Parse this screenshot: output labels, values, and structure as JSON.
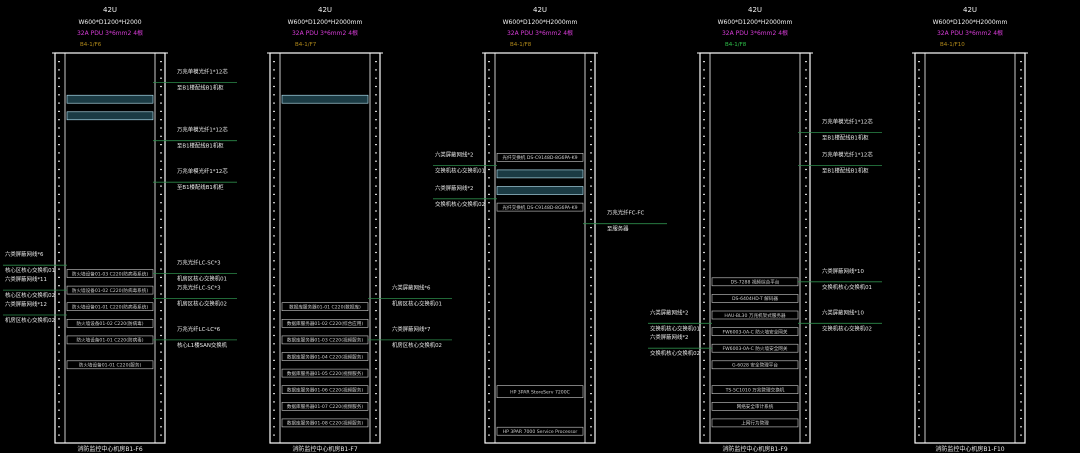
{
  "colors": {
    "background": "#000000",
    "rack": "#ffffff",
    "header": "#f2f2f2",
    "pdu": "#d63bd6",
    "id": "#b38b1a",
    "id_green": "#2ec24a",
    "leader": "#2c8a4a",
    "label": "#eaeaea",
    "device": "#cfcfcf",
    "highlight": "#bfefff"
  },
  "racks": [
    {
      "name": "rack-1",
      "size": "42U",
      "dims": "W600*D1200*H2000",
      "pdu": "32A PDU 3*6mm2 4根",
      "id": "B4-1/F6",
      "id_color": "id",
      "devices": [
        {
          "label": "",
          "u": 4,
          "style": "hl"
        },
        {
          "label": "",
          "u": 6,
          "style": "hl"
        },
        {
          "label": "防火墙设备01-03 C220(防病毒系统)",
          "u": 25
        },
        {
          "label": "防火墙设备01-02 C220(防病毒系统)",
          "u": 27
        },
        {
          "label": "防火墙设备01-01 C220(防病毒系统)",
          "u": 29
        },
        {
          "label": "防火墙设备01-02 C220(防病毒)",
          "u": 31
        },
        {
          "label": "防火墙设备01-01 C220(防病毒)",
          "u": 33
        },
        {
          "label": "防火墙设备01-01 C220(服务)",
          "u": 36
        }
      ],
      "callouts": [
        {
          "side": "right",
          "u": 2,
          "lines": [
            "万兆单模光纤1*12芯",
            "至B1楼配线B1机柜"
          ]
        },
        {
          "side": "right",
          "u": 9,
          "lines": [
            "万兆单模光纤1*12芯",
            "至B1楼配线B1机柜"
          ]
        },
        {
          "side": "right",
          "u": 14,
          "lines": [
            "万兆单模光纤1*12芯",
            "至B1楼配线B1机柜"
          ]
        },
        {
          "side": "right",
          "u": 25,
          "lines": [
            "万兆光纤LC-SC*3",
            "机房区核心交换机01"
          ]
        },
        {
          "side": "right",
          "u": 28,
          "lines": [
            "万兆光纤LC-SC*3",
            "机房区核心交换机02"
          ]
        },
        {
          "side": "right",
          "u": 33,
          "lines": [
            "万兆光纤LC-LC*6",
            "核心L1楼SAN交换机"
          ]
        },
        {
          "side": "left",
          "u": 24,
          "lines": [
            "六类屏蔽网线*6",
            "核心区核心交换机01"
          ]
        },
        {
          "side": "left",
          "u": 27,
          "lines": [
            "六类屏蔽网线*11",
            "核心区核心交换机02"
          ]
        },
        {
          "side": "left",
          "u": 30,
          "lines": [
            "六类屏蔽网线*12",
            "机房区核心交换机02"
          ]
        }
      ],
      "footer": "消防监控中心机房B1-F6"
    },
    {
      "name": "rack-2",
      "size": "42U",
      "dims": "W600*D1200*H2000mm",
      "pdu": "32A PDU 3*6mm2 4根",
      "id": "B4-1/F7",
      "id_color": "id",
      "devices": [
        {
          "label": "",
          "u": 4,
          "style": "hl"
        },
        {
          "label": "数据库服务器01-01 C220(数据库)",
          "u": 29
        },
        {
          "label": "数据库服务器01-02 C220(综合应用)",
          "u": 31
        },
        {
          "label": "数据库服务器01-03 C220(视频服务)",
          "u": 33
        },
        {
          "label": "数据库服务器01-04 C220(视频服务)",
          "u": 35
        },
        {
          "label": "数据库服务器01-05 C220(视频服务)",
          "u": 37
        },
        {
          "label": "数据库服务器01-06 C220(视频服务)",
          "u": 39
        },
        {
          "label": "数据库服务器01-07 C220(视频服务)",
          "u": 41
        },
        {
          "label": "数据库服务器01-08 C220(视频服务)",
          "u": 43
        }
      ],
      "callouts": [
        {
          "side": "right",
          "u": 28,
          "lines": [
            "六类屏蔽网线*6",
            "机房区核心交换机01"
          ]
        },
        {
          "side": "right",
          "u": 33,
          "lines": [
            "六类屏蔽网线*7",
            "机房区核心交换机02"
          ]
        }
      ],
      "footer": "消防监控中心机房B1-F7"
    },
    {
      "name": "rack-3",
      "size": "42U",
      "dims": "W600*D1200*H2000mm",
      "pdu": "32A PDU 3*6mm2 4根",
      "id": "B4-1/F8",
      "id_color": "id",
      "devices": [
        {
          "label": "光纤交换机 DS-C9148D-8G6PA-K9",
          "u": 11
        },
        {
          "label": "",
          "u": 13,
          "style": "hl"
        },
        {
          "label": "",
          "u": 15,
          "style": "hl"
        },
        {
          "label": "光纤交换机 DS-C9148D-8G6PA-K9",
          "u": 17
        },
        {
          "label": "HP 3PAR StoreServ 7200C",
          "u": 39,
          "tall": true
        },
        {
          "label": "HP 3PAR 7000 Service Processor",
          "u": 44
        }
      ],
      "callouts": [
        {
          "side": "left",
          "u": 12,
          "lines": [
            "六类屏蔽网线*2",
            "交换机核心交换机01"
          ]
        },
        {
          "side": "left",
          "u": 16,
          "lines": [
            "六类屏蔽网线*2",
            "交换机核心交换机02"
          ]
        },
        {
          "side": "right",
          "u": 19,
          "lines": [
            "万兆光纤FC-FC",
            "至服务器"
          ]
        }
      ],
      "footer": ""
    },
    {
      "name": "rack-4",
      "size": "42U",
      "dims": "W600*D1200*H2000mm",
      "pdu": "32A PDU 3*6mm2 4根",
      "id": "B4-1/F8",
      "id_color": "id_green",
      "devices": [
        {
          "label": "DS-7288 视频综合平台",
          "u": 26
        },
        {
          "label": "DS-6404HD-T 解码器",
          "u": 28
        },
        {
          "label": "HAU-BL30 万兆机架式服务器",
          "u": 30
        },
        {
          "label": "FW6003-0A-C 防火墙安全网关",
          "u": 32
        },
        {
          "label": "FW6003-0A-C 防火墙安全网关",
          "u": 34
        },
        {
          "label": "G-6028 安全管理平台",
          "u": 36
        },
        {
          "label": "TS-5C1010 万兆管理交换机",
          "u": 39
        },
        {
          "label": "网络安全审计系统",
          "u": 41
        },
        {
          "label": "上网行为管理",
          "u": 43
        }
      ],
      "callouts": [
        {
          "side": "right",
          "u": 8,
          "lines": [
            "万兆单模光纤1*12芯",
            "至B1楼配线B1机柜"
          ]
        },
        {
          "side": "right",
          "u": 12,
          "lines": [
            "万兆单模光纤1*12芯",
            "至B1楼配线B1机柜"
          ]
        },
        {
          "side": "right",
          "u": 26,
          "lines": [
            "六类屏蔽网线*10",
            "交换机核心交换机01"
          ]
        },
        {
          "side": "right",
          "u": 31,
          "lines": [
            "六类屏蔽网线*10",
            "交换机核心交换机02"
          ]
        },
        {
          "side": "left",
          "u": 31,
          "lines": [
            "六类屏蔽网线*2",
            "交换机核心交换机01"
          ]
        },
        {
          "side": "left",
          "u": 34,
          "lines": [
            "六类屏蔽网线*2",
            "交换机核心交换机02"
          ]
        }
      ],
      "footer": "消防监控中心机房B1-F9"
    },
    {
      "name": "rack-5",
      "size": "42U",
      "dims": "W600*D1200*H2000mm",
      "pdu": "32A PDU 3*6mm2 4根",
      "id": "B4-1/F10",
      "id_color": "id",
      "devices": [],
      "callouts": [],
      "footer": "消防监控中心机房B1-F10"
    }
  ]
}
